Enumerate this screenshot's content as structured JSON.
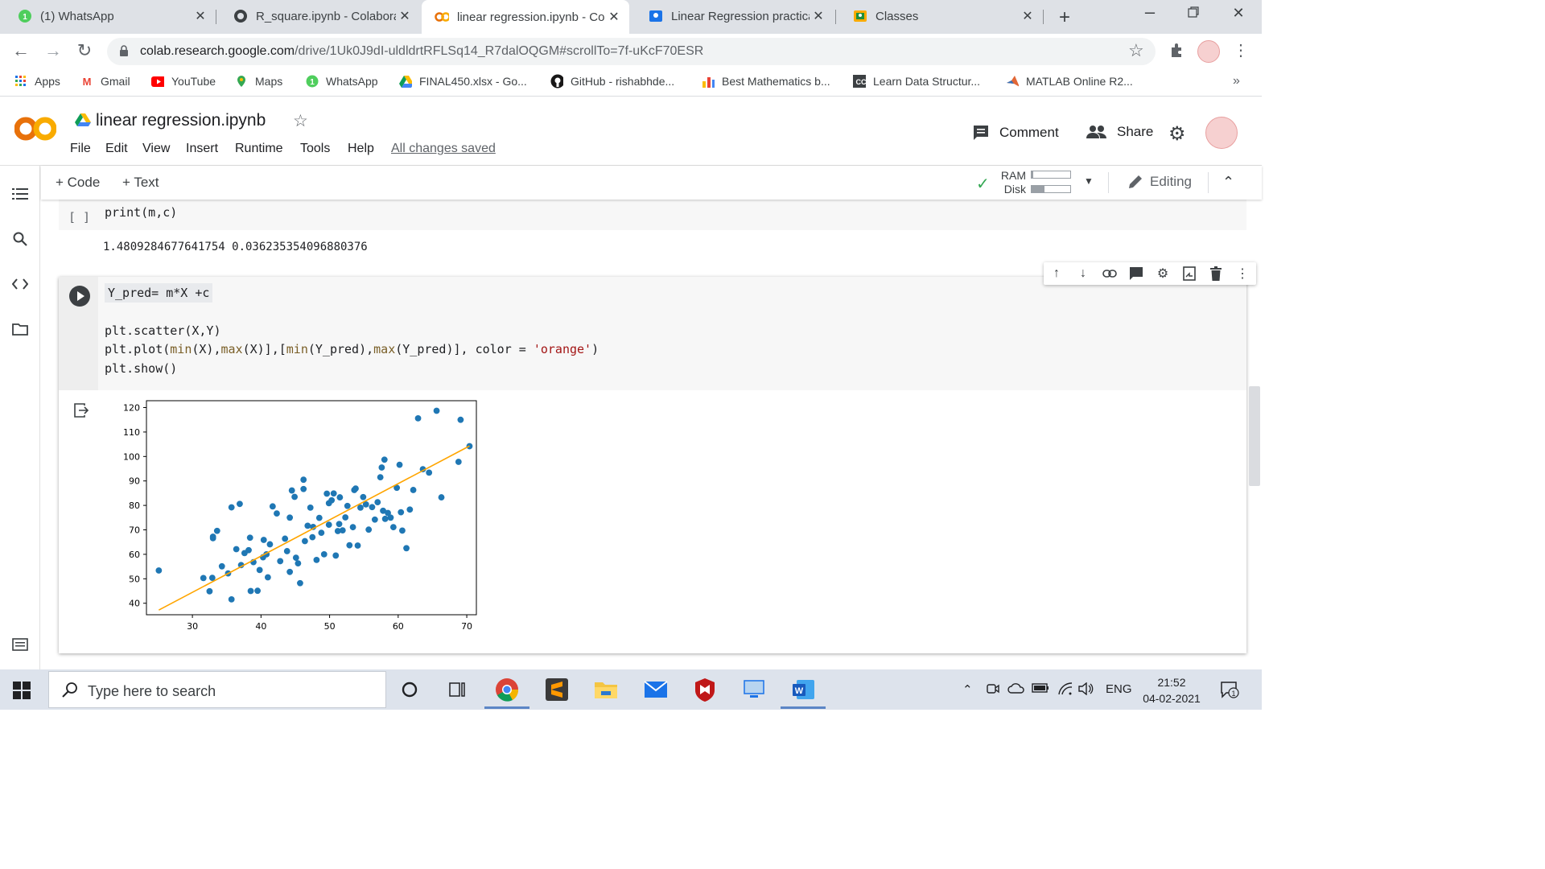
{
  "browser": {
    "tabs": [
      {
        "title": "(1) WhatsApp",
        "icon": "whatsapp-icon"
      },
      {
        "title": "R_square.ipynb - Colaborat",
        "icon": "github-icon"
      },
      {
        "title": "linear regression.ipynb - Co",
        "icon": "colab-icon",
        "active": true
      },
      {
        "title": "Linear Regression practical",
        "icon": "classroom-icon"
      },
      {
        "title": "Classes",
        "icon": "classroom-icon"
      }
    ],
    "url_host": "colab.research.google.com",
    "url_path": "/drive/1Uk0J9dI-uldldrtRFLSq14_R7dalOQGM#scrollTo=7f-uKcF70ESR",
    "bookmarks": [
      "Apps",
      "Gmail",
      "YouTube",
      "Maps",
      "WhatsApp",
      "FINAL450.xlsx - Go...",
      "GitHub - rishabhde...",
      "Best Mathematics b...",
      "Learn Data Structur...",
      "MATLAB Online R2..."
    ],
    "bookmarks_more": "»"
  },
  "colab": {
    "title": "linear regression.ipynb",
    "menu": [
      "File",
      "Edit",
      "View",
      "Insert",
      "Runtime",
      "Tools",
      "Help"
    ],
    "saved_status": "All changes saved",
    "comment_label": "Comment",
    "share_label": "Share",
    "add_code_label": "+ Code",
    "add_text_label": "+ Text",
    "ram_label": "RAM",
    "disk_label": "Disk",
    "ram_usage": 0.04,
    "disk_usage": 0.34,
    "editing_label": "Editing"
  },
  "cells": {
    "cell1": {
      "bracket": "[ ]",
      "code": "print(m,c)",
      "output": "1.4809284677641754 0.036235354096880376"
    },
    "cell2": {
      "line1": "Y_pred= m*X +c",
      "line2": "plt.scatter(X,Y)",
      "line3_a": "plt.plot(",
      "line3_b": "min",
      "line3_c": "(X),",
      "line3_d": "max",
      "line3_e": "(X)],[",
      "line3_f": "min",
      "line3_g": "(Y_pred),",
      "line3_h": "max",
      "line3_i": "(Y_pred)], color = ",
      "line3_j": "'orange'",
      "line3_k": ")",
      "line4": "plt.show()"
    }
  },
  "chart_data": {
    "type": "scatter",
    "title": "",
    "xlabel": "",
    "ylabel": "",
    "xlim": [
      23.3,
      71.4
    ],
    "ylim": [
      35.3,
      122.8
    ],
    "xticks": [
      30,
      40,
      50,
      60,
      70
    ],
    "yticks": [
      40,
      50,
      60,
      70,
      80,
      90,
      100,
      110,
      120
    ],
    "grid": false,
    "series": [
      {
        "kind": "scatter",
        "color": "#1f77b4",
        "x": [
          25.1,
          31.6,
          32.5,
          32.9,
          33.0,
          33.6,
          34.3,
          35.2,
          35.7,
          36.4,
          37.1,
          37.6,
          38.2,
          38.5,
          38.9,
          39.5,
          39.8,
          40.4,
          40.8,
          41.0,
          41.3,
          41.7,
          42.3,
          42.8,
          43.5,
          43.8,
          44.2,
          44.5,
          44.9,
          45.1,
          45.4,
          45.7,
          46.2,
          46.4,
          46.8,
          47.2,
          47.6,
          48.1,
          48.5,
          48.8,
          49.2,
          49.6,
          49.9,
          50.3,
          50.6,
          50.9,
          51.2,
          51.5,
          51.9,
          52.3,
          52.6,
          52.9,
          53.4,
          53.8,
          54.1,
          54.5,
          54.9,
          55.3,
          55.7,
          56.2,
          56.6,
          57.0,
          57.4,
          57.8,
          58.1,
          58.5,
          58.9,
          59.3,
          59.8,
          60.2,
          60.6,
          61.2,
          61.7,
          62.2,
          62.9,
          63.6,
          64.5,
          65.6,
          66.3,
          68.8,
          69.1,
          70.4,
          36.9,
          35.7,
          46.2,
          38.4,
          44.2,
          51.4,
          53.6,
          57.6,
          58.0,
          60.4,
          49.9,
          47.5,
          40.3,
          33.0
        ],
        "y": [
          53.4,
          50.3,
          44.9,
          50.4,
          67.2,
          69.6,
          55.1,
          52.2,
          41.6,
          62.1,
          55.6,
          60.5,
          61.7,
          45.0,
          56.8,
          45.1,
          53.6,
          65.9,
          60.0,
          50.6,
          64.1,
          79.6,
          76.7,
          57.2,
          66.4,
          61.3,
          52.8,
          86.1,
          83.5,
          58.6,
          56.3,
          48.2,
          90.5,
          65.4,
          71.7,
          79.1,
          71.2,
          57.7,
          74.9,
          68.8,
          60.0,
          84.8,
          80.9,
          82.1,
          84.9,
          59.5,
          69.5,
          83.3,
          69.8,
          75.1,
          79.8,
          63.7,
          71.1,
          86.9,
          63.6,
          79.1,
          83.4,
          80.4,
          70.1,
          79.3,
          74.2,
          81.3,
          91.5,
          77.8,
          74.5,
          76.9,
          75.0,
          71.1,
          87.2,
          96.6,
          69.7,
          62.5,
          78.3,
          86.3,
          115.6,
          94.8,
          93.4,
          118.7,
          83.3,
          97.8,
          115.0,
          104.2,
          80.6,
          79.2,
          86.7,
          66.8,
          75.0,
          72.4,
          86.3,
          95.5,
          98.7,
          77.2,
          72.1,
          67.0,
          58.8,
          66.6
        ]
      },
      {
        "kind": "line",
        "color": "orange",
        "x": [
          25.1,
          70.4
        ],
        "y": [
          37.2,
          104.3
        ]
      }
    ]
  },
  "taskbar": {
    "search_placeholder": "Type here to search",
    "lang": "ENG",
    "time": "21:52",
    "date": "04-02-2021",
    "notif_count": "1"
  },
  "colors": {
    "tabstrip": "#dee1e6",
    "taskbar": "#dde3ec",
    "scatter": "#1f77b4",
    "fit_line": "orange"
  }
}
